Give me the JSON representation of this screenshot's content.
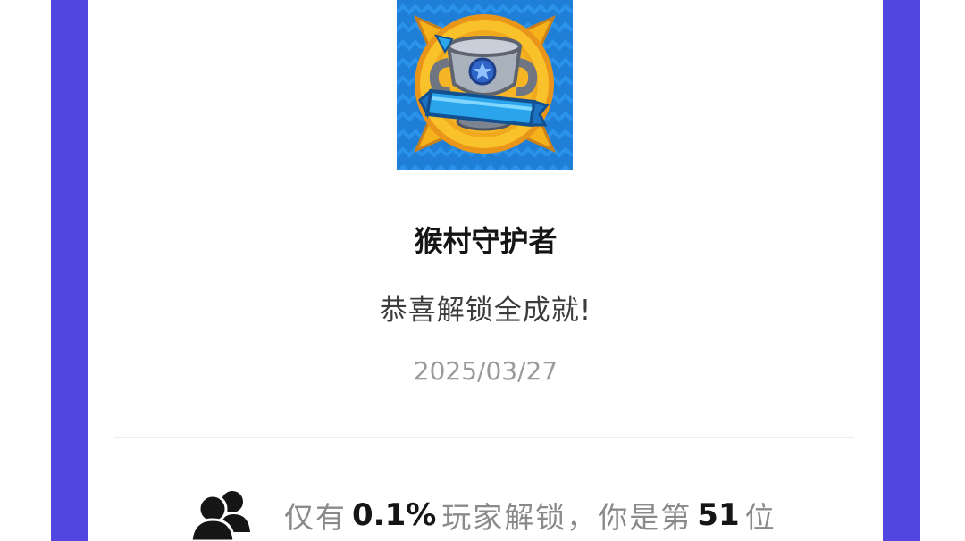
{
  "colors": {
    "side_band": "#5147e0",
    "title": "#151515",
    "subtitle": "#3c3c3c",
    "date": "#9a9a9a",
    "muted": "#8a8a8a",
    "badge_bg": "#1f7fd6",
    "badge_gold": "#f6b21b",
    "trophy_silver": "#a9b1bd"
  },
  "achievement": {
    "icon": "trophy-badge-icon",
    "title": "猴村守护者",
    "subtitle": "恭喜解锁全成就!",
    "date": "2025/03/27"
  },
  "stats": {
    "icon": "users-icon",
    "prefix": "仅有",
    "percent": "0.1%",
    "middle": "玩家解锁，你是第",
    "rank": "51",
    "suffix": "位"
  }
}
